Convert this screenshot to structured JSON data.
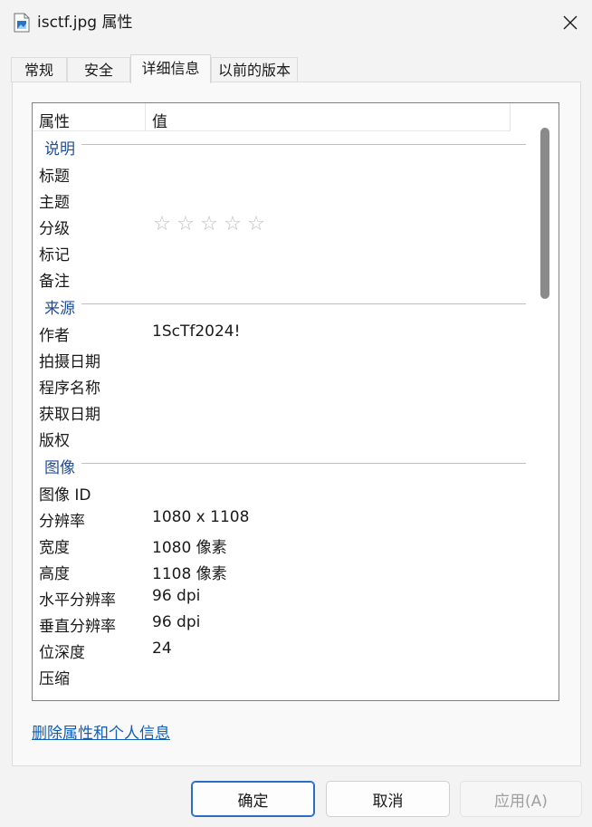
{
  "window": {
    "title": "isctf.jpg 属性",
    "file_icon": "image-file-icon",
    "close_icon": "close-icon"
  },
  "tabs": [
    {
      "label": "常规",
      "active": false
    },
    {
      "label": "安全",
      "active": false
    },
    {
      "label": "详细信息",
      "active": true
    },
    {
      "label": "以前的版本",
      "active": false
    }
  ],
  "list": {
    "header": {
      "name": "属性",
      "value": "值"
    },
    "groups": [
      {
        "label": "说明",
        "rows": [
          {
            "name": "标题",
            "value": ""
          },
          {
            "name": "主题",
            "value": ""
          },
          {
            "name": "分级",
            "value": "",
            "rating": 0,
            "rating_max": 5
          },
          {
            "name": "标记",
            "value": ""
          },
          {
            "name": "备注",
            "value": ""
          }
        ]
      },
      {
        "label": "来源",
        "rows": [
          {
            "name": "作者",
            "value": "1ScTf2024!"
          },
          {
            "name": "拍摄日期",
            "value": ""
          },
          {
            "name": "程序名称",
            "value": ""
          },
          {
            "name": "获取日期",
            "value": ""
          },
          {
            "name": "版权",
            "value": ""
          }
        ]
      },
      {
        "label": "图像",
        "rows": [
          {
            "name": "图像 ID",
            "value": ""
          },
          {
            "name": "分辨率",
            "value": "1080 x 1108"
          },
          {
            "name": "宽度",
            "value": "1080 像素"
          },
          {
            "name": "高度",
            "value": "1108 像素"
          },
          {
            "name": "水平分辨率",
            "value": "96 dpi"
          },
          {
            "name": "垂直分辨率",
            "value": "96 dpi"
          },
          {
            "name": "位深度",
            "value": "24"
          },
          {
            "name": "压缩",
            "value": ""
          }
        ]
      }
    ],
    "star_glyph": "☆"
  },
  "link": {
    "label": "删除属性和个人信息"
  },
  "buttons": {
    "ok": "确定",
    "cancel": "取消",
    "apply": "应用(A)"
  },
  "colors": {
    "group_label": "#1f4e9a",
    "link": "#0f5fb8",
    "primary_border": "#2b6cc4"
  }
}
